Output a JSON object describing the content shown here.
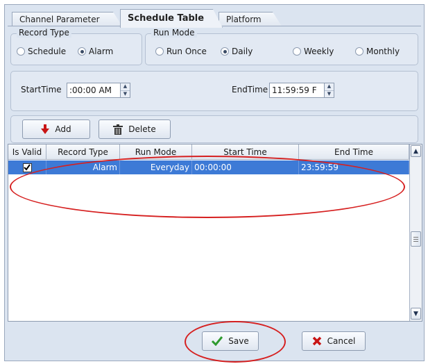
{
  "tabs": [
    {
      "label": "Channel Parameter",
      "active": false
    },
    {
      "label": "Schedule Table",
      "active": true
    },
    {
      "label": "Platform",
      "active": false
    }
  ],
  "record_type": {
    "title": "Record Type",
    "options": [
      {
        "label": "Schedule",
        "selected": false
      },
      {
        "label": "Alarm",
        "selected": true
      }
    ]
  },
  "run_mode": {
    "title": "Run Mode",
    "options": [
      {
        "label": "Run Once",
        "selected": false
      },
      {
        "label": "Daily",
        "selected": true
      },
      {
        "label": "Weekly",
        "selected": false
      },
      {
        "label": "Monthly",
        "selected": false
      }
    ]
  },
  "time": {
    "start_label": "StartTime",
    "start_value": ":00:00 AM",
    "end_label": "EndTime",
    "end_value": "11:59:59 F"
  },
  "buttons": {
    "add": "Add",
    "delete": "Delete",
    "save": "Save",
    "cancel": "Cancel"
  },
  "table": {
    "columns": [
      "Is Valid",
      "Record Type",
      "Run Mode",
      "Start Time",
      "End Time"
    ],
    "rows": [
      {
        "is_valid": true,
        "record_type": "Alarm",
        "run_mode": "Everyday",
        "start_time": "00:00:00",
        "end_time": "23:59:59"
      }
    ]
  },
  "colors": {
    "selection": "#3d7ad6",
    "annotation": "#d62020",
    "panel_bg": "#dbe4f0"
  }
}
